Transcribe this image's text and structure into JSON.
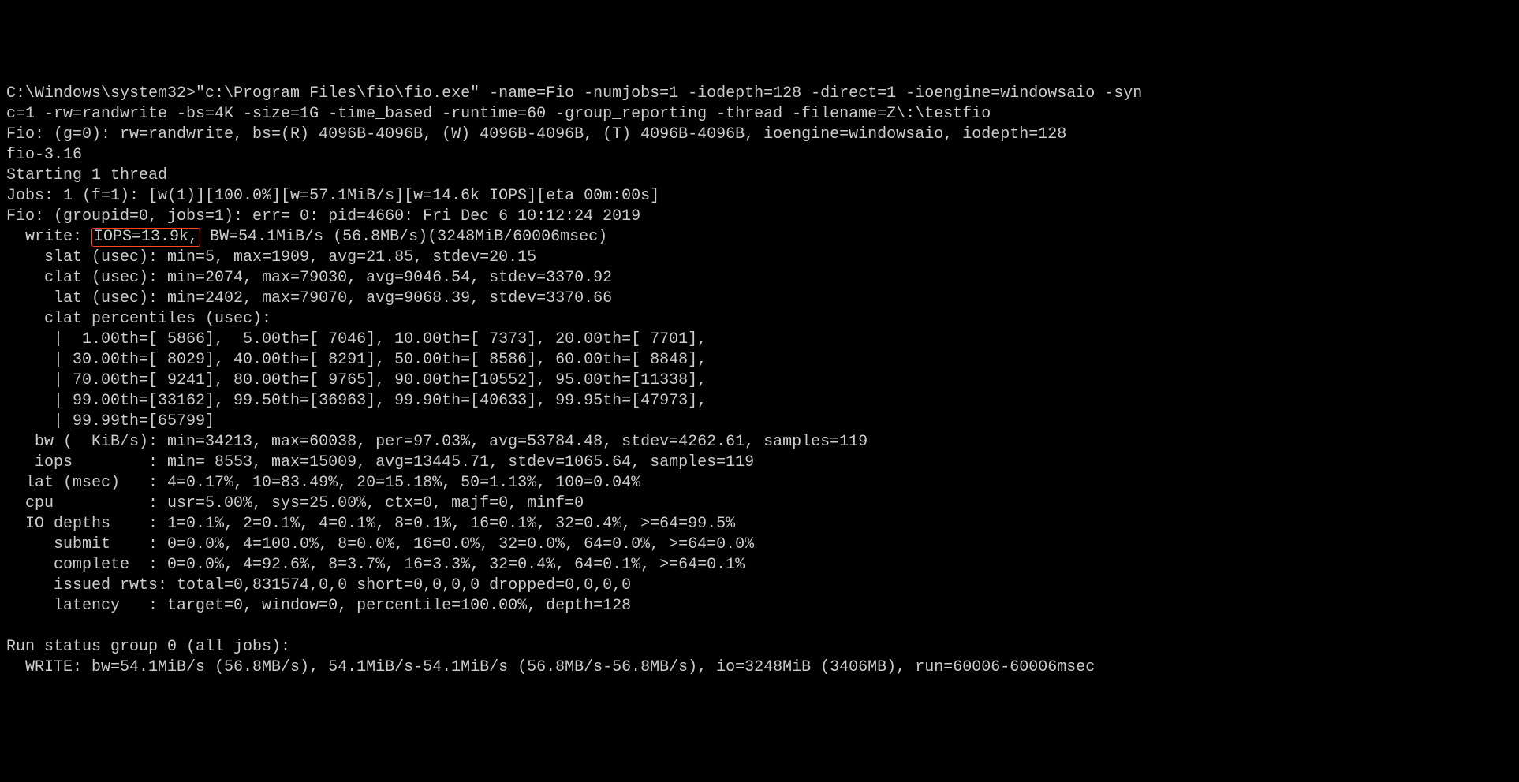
{
  "terminal": {
    "line01": "C:\\Windows\\system32>\"c:\\Program Files\\fio\\fio.exe\" -name=Fio -numjobs=1 -iodepth=128 -direct=1 -ioengine=windowsaio -syn",
    "line02": "c=1 -rw=randwrite -bs=4K -size=1G -time_based -runtime=60 -group_reporting -thread -filename=Z\\:\\testfio",
    "line03": "Fio: (g=0): rw=randwrite, bs=(R) 4096B-4096B, (W) 4096B-4096B, (T) 4096B-4096B, ioengine=windowsaio, iodepth=128",
    "line04": "fio-3.16",
    "line05": "Starting 1 thread",
    "line06": "Jobs: 1 (f=1): [w(1)][100.0%][w=57.1MiB/s][w=14.6k IOPS][eta 00m:00s]",
    "line07": "Fio: (groupid=0, jobs=1): err= 0: pid=4660: Fri Dec 6 10:12:24 2019",
    "line08a": "  write: ",
    "line08b": "IOPS=13.9k,",
    "line08c": " BW=54.1MiB/s (56.8MB/s)(3248MiB/60006msec)",
    "line09": "    slat (usec): min=5, max=1909, avg=21.85, stdev=20.15",
    "line10": "    clat (usec): min=2074, max=79030, avg=9046.54, stdev=3370.92",
    "line11": "     lat (usec): min=2402, max=79070, avg=9068.39, stdev=3370.66",
    "line12": "    clat percentiles (usec):",
    "line13": "     |  1.00th=[ 5866],  5.00th=[ 7046], 10.00th=[ 7373], 20.00th=[ 7701],",
    "line14": "     | 30.00th=[ 8029], 40.00th=[ 8291], 50.00th=[ 8586], 60.00th=[ 8848],",
    "line15": "     | 70.00th=[ 9241], 80.00th=[ 9765], 90.00th=[10552], 95.00th=[11338],",
    "line16": "     | 99.00th=[33162], 99.50th=[36963], 99.90th=[40633], 99.95th=[47973],",
    "line17": "     | 99.99th=[65799]",
    "line18": "   bw (  KiB/s): min=34213, max=60038, per=97.03%, avg=53784.48, stdev=4262.61, samples=119",
    "line19": "   iops        : min= 8553, max=15009, avg=13445.71, stdev=1065.64, samples=119",
    "line20": "  lat (msec)   : 4=0.17%, 10=83.49%, 20=15.18%, 50=1.13%, 100=0.04%",
    "line21": "  cpu          : usr=5.00%, sys=25.00%, ctx=0, majf=0, minf=0",
    "line22": "  IO depths    : 1=0.1%, 2=0.1%, 4=0.1%, 8=0.1%, 16=0.1%, 32=0.4%, >=64=99.5%",
    "line23": "     submit    : 0=0.0%, 4=100.0%, 8=0.0%, 16=0.0%, 32=0.0%, 64=0.0%, >=64=0.0%",
    "line24": "     complete  : 0=0.0%, 4=92.6%, 8=3.7%, 16=3.3%, 32=0.4%, 64=0.1%, >=64=0.1%",
    "line25": "     issued rwts: total=0,831574,0,0 short=0,0,0,0 dropped=0,0,0,0",
    "line26": "     latency   : target=0, window=0, percentile=100.00%, depth=128",
    "line27": "",
    "line28": "Run status group 0 (all jobs):",
    "line29": "  WRITE: bw=54.1MiB/s (56.8MB/s), 54.1MiB/s-54.1MiB/s (56.8MB/s-56.8MB/s), io=3248MiB (3406MB), run=60006-60006msec"
  }
}
